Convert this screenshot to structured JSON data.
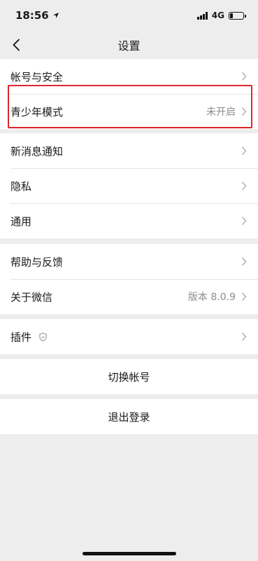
{
  "status_bar": {
    "time": "18:56",
    "network": "4G"
  },
  "nav": {
    "title": "设置"
  },
  "groups": [
    [
      {
        "label": "帐号与安全"
      },
      {
        "label": "青少年模式",
        "value": "未开启"
      }
    ],
    [
      {
        "label": "新消息通知"
      },
      {
        "label": "隐私"
      },
      {
        "label": "通用"
      }
    ],
    [
      {
        "label": "帮助与反馈"
      },
      {
        "label": "关于微信",
        "value": "版本 8.0.9"
      }
    ],
    [
      {
        "label": "插件"
      }
    ]
  ],
  "actions": {
    "switch_account": "切换帐号",
    "logout": "退出登录"
  },
  "colors": {
    "highlight": "#e0262a",
    "background": "#ededed",
    "secondary_text": "#8c8c8c"
  }
}
